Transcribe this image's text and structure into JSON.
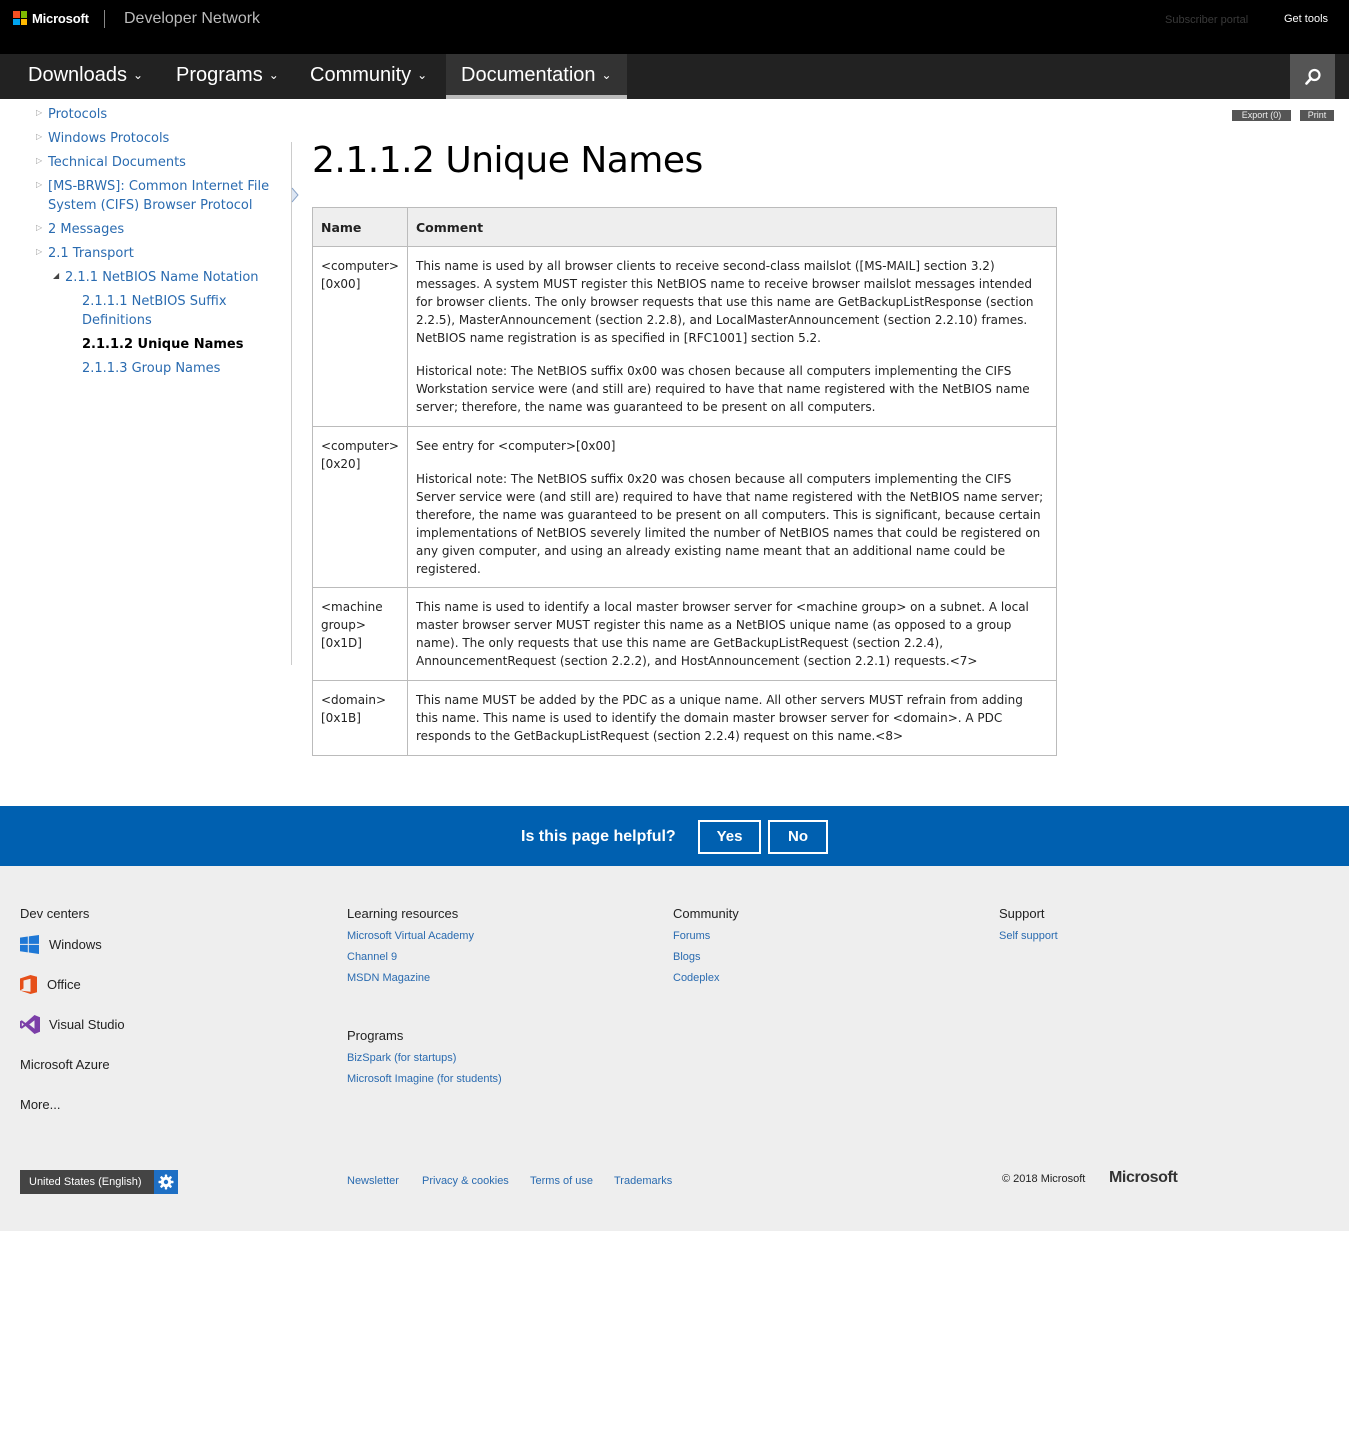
{
  "header": {
    "brand": "Microsoft",
    "site_name": "Developer Network",
    "subscriber_portal": "Subscriber portal",
    "get_tools": "Get tools"
  },
  "nav": {
    "items": [
      {
        "label": "Downloads"
      },
      {
        "label": "Programs"
      },
      {
        "label": "Community"
      },
      {
        "label": "Documentation"
      }
    ],
    "search_icon": "search-icon"
  },
  "toolbar": {
    "export_label": "Export (0)",
    "print_label": "Print"
  },
  "toc": {
    "items": [
      {
        "label": "Protocols"
      },
      {
        "label": "Windows Protocols"
      },
      {
        "label": "Technical Documents"
      },
      {
        "label": "[MS-BRWS]: Common Internet File System (CIFS) Browser Protocol"
      },
      {
        "label": "2 Messages"
      },
      {
        "label": "2.1 Transport"
      },
      {
        "label": "2.1.1 NetBIOS Name Notation"
      },
      {
        "label": "2.1.1.1 NetBIOS Suffix Definitions"
      },
      {
        "label": "2.1.1.2 Unique Names"
      },
      {
        "label": "2.1.1.3 Group Names"
      }
    ]
  },
  "main": {
    "title": "2.1.1.2 Unique Names",
    "table": {
      "headers": [
        "Name",
        "Comment"
      ],
      "rows": [
        {
          "name": "<computer>[0x00]",
          "p1": "This name is used by all browser clients to receive second-class mailslot ([MS-MAIL] section 3.2) messages. A system MUST register this NetBIOS name to receive browser mailslot messages intended for browser clients. The only browser requests that use this name are GetBackupListResponse (section 2.2.5), MasterAnnouncement (section 2.2.8), and LocalMasterAnnouncement (section 2.2.10) frames. NetBIOS name registration is as specified in [RFC1001] section 5.2.",
          "p2": "Historical note: The NetBIOS suffix 0x00 was chosen because all computers implementing the CIFS Workstation service were (and still are) required to have that name registered with the NetBIOS name server; therefore, the name was guaranteed to be present on all computers."
        },
        {
          "name": "<computer>[0x20]",
          "p1": "See entry for <computer>[0x00]",
          "p2": "Historical note: The NetBIOS suffix 0x20 was chosen because all computers implementing the CIFS Server service were (and still are) required to have that name registered with the NetBIOS name server; therefore, the name was guaranteed to be present on all computers. This is significant, because certain implementations of NetBIOS severely limited the number of NetBIOS names that could be registered on any given computer, and using an already existing name meant that an additional name could be registered."
        },
        {
          "name": "<machine group>[0x1D]",
          "p1": "This name is used to identify a local master browser server for <machine group> on a subnet. A local master browser server MUST register this name as a NetBIOS unique name (as opposed to a group name). The only requests that use this name are GetBackupListRequest (section 2.2.4), AnnouncementRequest (section 2.2.2), and HostAnnouncement (section 2.2.1) requests.<7>"
        },
        {
          "name": "<domain>[0x1B]",
          "p1": "This name MUST be added by the PDC as a unique name. All other servers MUST refrain from adding this name. This name is used to identify the domain master browser server for <domain>. A PDC responds to the GetBackupListRequest (section 2.2.4) request on this name.<8>"
        }
      ]
    }
  },
  "feedback": {
    "question": "Is this page helpful?",
    "yes": "Yes",
    "no": "No"
  },
  "footer": {
    "dev_centers": {
      "heading": "Dev centers",
      "items": [
        {
          "label": "Windows",
          "icon": "windows-icon"
        },
        {
          "label": "Office",
          "icon": "office-icon"
        },
        {
          "label": "Visual Studio",
          "icon": "visual-studio-icon"
        },
        {
          "label": "Microsoft Azure"
        },
        {
          "label": "More..."
        }
      ]
    },
    "learning": {
      "heading": "Learning resources",
      "links": [
        "Microsoft Virtual Academy",
        "Channel 9",
        "MSDN Magazine"
      ]
    },
    "community": {
      "heading": "Community",
      "links": [
        "Forums",
        "Blogs",
        "Codeplex"
      ]
    },
    "support": {
      "heading": "Support",
      "links": [
        "Self support"
      ]
    },
    "programs": {
      "heading": "Programs",
      "links": [
        "BizSpark (for startups)",
        "Microsoft Imagine (for students)"
      ]
    },
    "locale": "United States (English)",
    "bottom_links": [
      "Newsletter",
      "Privacy & cookies",
      "Terms of use",
      "Trademarks"
    ],
    "copyright": "© 2018 Microsoft",
    "brand": "Microsoft"
  },
  "colors": {
    "link": "#2a6bb0",
    "feedback_bar": "#0060b0",
    "topbar": "#000000",
    "navbar": "#222222",
    "footer_bg": "#eeeeee"
  }
}
